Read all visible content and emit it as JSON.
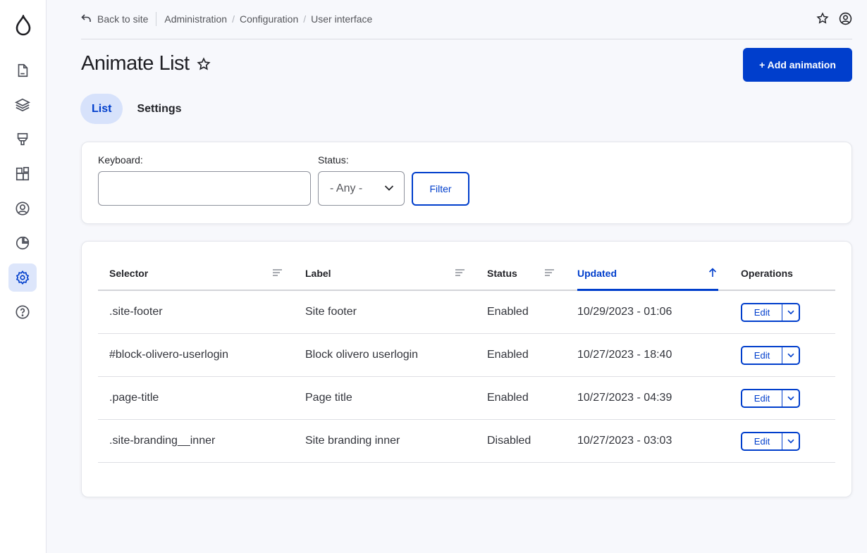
{
  "colors": {
    "accent": "#003ecc",
    "accent_light": "#d7e2fb",
    "background": "#f7f8fc"
  },
  "sidebar": {
    "logo_icon": "drupal-drop-icon",
    "items": [
      {
        "icon": "content-page-icon"
      },
      {
        "icon": "structure-layers-icon"
      },
      {
        "icon": "appearance-brush-icon"
      },
      {
        "icon": "extend-blocks-icon"
      },
      {
        "icon": "people-user-icon"
      },
      {
        "icon": "reports-pie-icon"
      },
      {
        "icon": "configuration-gear-icon",
        "active": true
      },
      {
        "icon": "help-question-icon"
      }
    ]
  },
  "breadcrumb": {
    "back": "Back to site",
    "items": [
      "Administration",
      "Configuration",
      "User interface"
    ]
  },
  "header": {
    "title": "Animate List",
    "add_button": "+ Add animation"
  },
  "tabs": [
    {
      "label": "List",
      "active": true
    },
    {
      "label": "Settings",
      "active": false
    }
  ],
  "filter": {
    "keyword_label": "Keyboard:",
    "keyword_value": "",
    "status_label": "Status:",
    "status_value": "- Any -",
    "filter_button": "Filter"
  },
  "table": {
    "columns": [
      "Selector",
      "Label",
      "Status",
      "Updated",
      "Operations"
    ],
    "sorted_column": "Updated",
    "rows": [
      {
        "selector": ".site-footer",
        "label": "Site footer",
        "status": "Enabled",
        "updated": "10/29/2023 - 01:06",
        "op": "Edit"
      },
      {
        "selector": "#block-olivero-userlogin",
        "label": "Block olivero userlogin",
        "status": "Enabled",
        "updated": "10/27/2023 - 18:40",
        "op": "Edit"
      },
      {
        "selector": ".page-title",
        "label": "Page title",
        "status": "Enabled",
        "updated": "10/27/2023 - 04:39",
        "op": "Edit"
      },
      {
        "selector": ".site-branding__inner",
        "label": "Site branding inner",
        "status": "Disabled",
        "updated": "10/27/2023 - 03:03",
        "op": "Edit"
      }
    ]
  }
}
